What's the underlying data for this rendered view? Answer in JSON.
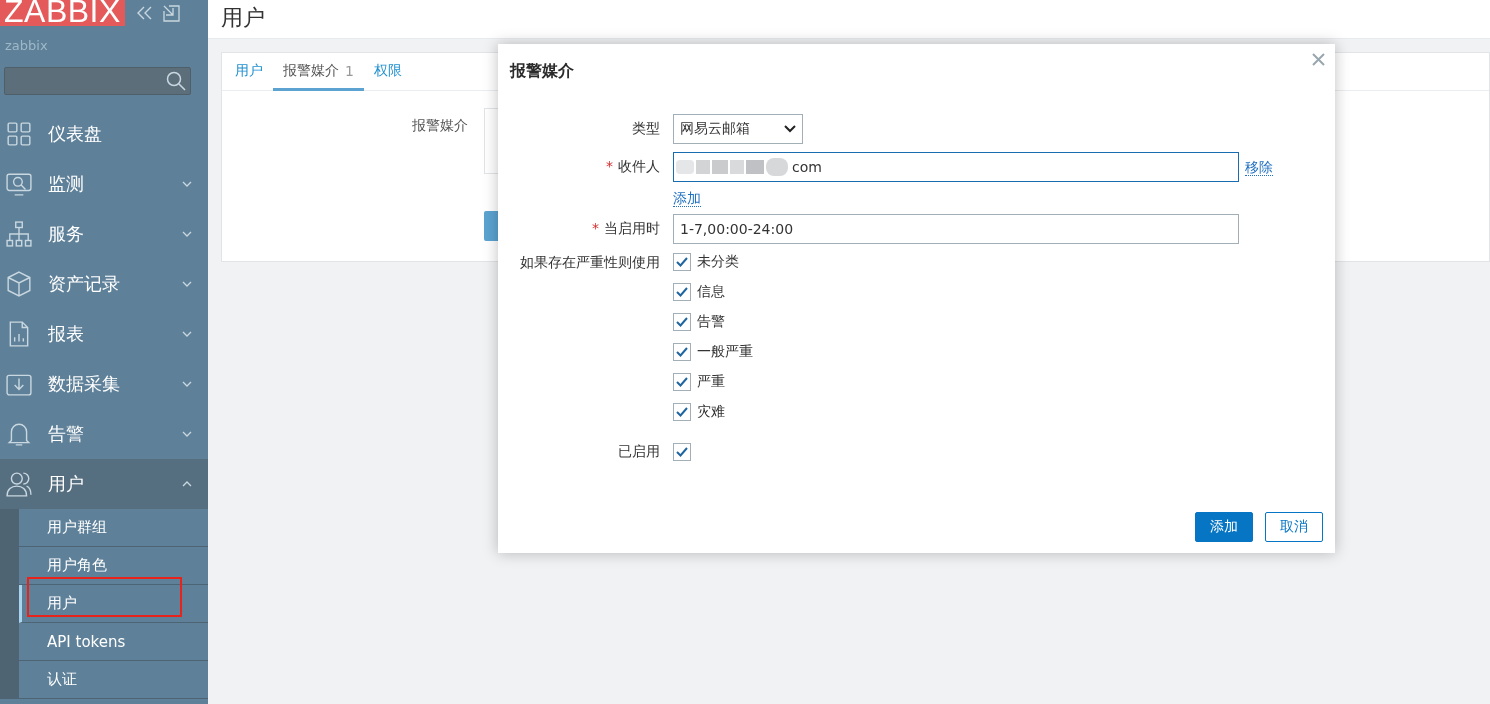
{
  "logo": {
    "text": "ZABBIX"
  },
  "sidebar": {
    "username": "zabbix",
    "menu": [
      {
        "label": "仪表盘",
        "kind": "link",
        "expanded": false
      },
      {
        "label": "监测",
        "kind": "group",
        "expanded": false
      },
      {
        "label": "服务",
        "kind": "group",
        "expanded": false
      },
      {
        "label": "资产记录",
        "kind": "group",
        "expanded": false
      },
      {
        "label": "报表",
        "kind": "group",
        "expanded": false
      },
      {
        "label": "数据采集",
        "kind": "group",
        "expanded": false
      },
      {
        "label": "告警",
        "kind": "group",
        "expanded": false
      },
      {
        "label": "用户",
        "kind": "group",
        "expanded": true,
        "children": [
          {
            "label": "用户群组",
            "selected": false,
            "highlighted": false
          },
          {
            "label": "用户角色",
            "selected": false,
            "highlighted": false
          },
          {
            "label": "用户",
            "selected": true,
            "highlighted": true
          },
          {
            "label": "API tokens",
            "selected": false,
            "highlighted": false
          },
          {
            "label": "认证",
            "selected": false,
            "highlighted": false
          }
        ]
      }
    ]
  },
  "page": {
    "title": "用户",
    "tabs": [
      {
        "label": "用户",
        "selected": false
      },
      {
        "label": "报警媒介",
        "count": "1",
        "selected": true
      },
      {
        "label": "权限",
        "selected": false
      }
    ],
    "form_label": "报警媒介"
  },
  "modal": {
    "title": "报警媒介",
    "required_mark": "*",
    "type": {
      "label": "类型",
      "value": "网易云邮箱"
    },
    "recipient": {
      "label": "收件人",
      "required": true,
      "value": "com",
      "remove": "移除",
      "add": "添加"
    },
    "when_active": {
      "label": "当启用时",
      "required": true,
      "value": "1-7,00:00-24:00"
    },
    "severity": {
      "label": "如果存在严重性则使用",
      "items": [
        {
          "label": "未分类",
          "checked": true
        },
        {
          "label": "信息",
          "checked": true
        },
        {
          "label": "告警",
          "checked": true
        },
        {
          "label": "一般严重",
          "checked": true
        },
        {
          "label": "严重",
          "checked": true
        },
        {
          "label": "灾难",
          "checked": true
        }
      ]
    },
    "enabled": {
      "label": "已启用",
      "checked": true
    },
    "buttons": [
      {
        "label": "添加",
        "kind": "primary"
      },
      {
        "label": "取消",
        "kind": "secondary"
      }
    ]
  }
}
